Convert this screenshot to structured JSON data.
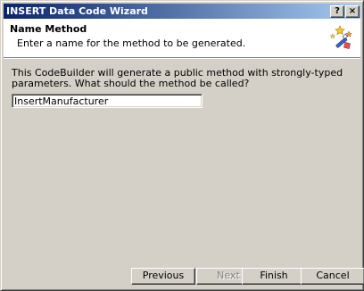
{
  "window": {
    "title": "INSERT Data Code Wizard",
    "help_label": "?",
    "close_label": "×"
  },
  "header": {
    "title": "Name Method",
    "subtitle": "Enter a name for the method to be generated.",
    "icon": "wizard-wand-icon"
  },
  "body": {
    "prompt": "This CodeBuilder will generate a public method with strongly-typed parameters.  What should the method be called?",
    "method_name_value": "InsertManufacturer"
  },
  "buttons": {
    "previous": "Previous",
    "next": "Next",
    "finish": "Finish",
    "cancel": "Cancel"
  },
  "colors": {
    "titlebar_start": "#0a246a",
    "titlebar_end": "#a6caf0",
    "face": "#d4d0c8",
    "disabled_text": "#808080"
  }
}
